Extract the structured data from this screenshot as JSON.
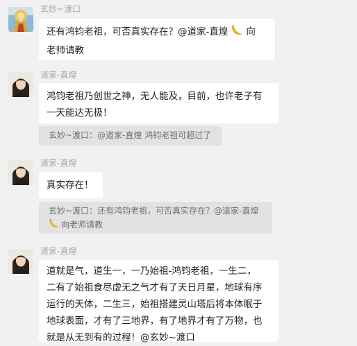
{
  "messages": [
    {
      "sender": "玄妙~渡口",
      "text_lines": [
        "还有鸿钧老祖，可否真实存在？@道家-直煌",
        "向",
        "老师请教"
      ],
      "emoji": "banana-emoji"
    },
    {
      "sender": "道家-直煌",
      "text_lines": [
        "鸿钧老祖乃创世之神，无人能及，目前，也许老子有",
        "一天能达无极！"
      ],
      "quote": "玄妙~渡口：@道家-直煌 鸿钧老祖可超过了"
    },
    {
      "sender": "道家-直煌",
      "text_lines": [
        "真实存在！"
      ],
      "quote_lines": [
        "玄妙~渡口：还有鸿钧老祖，可否真实存在？@道家-直煌",
        "向老师请教"
      ]
    },
    {
      "sender": "道家-直煌",
      "text_lines": [
        "道就是气，道生一，一乃始祖-鸿钧老祖，一生二，",
        "二有了始祖食尽虚无之气才有了天日月星，地球有序",
        "运行的天体，二生三，始祖搭建灵山塔后将本体眠于",
        "地球表面，才有了三地界，有了地界才有了万物，也",
        "就是从无到有的过程！@玄妙~渡口"
      ]
    }
  ],
  "colors": {
    "background": "#f1f1f1",
    "bubble": "#ffffff",
    "quote": "#e2e2e2",
    "sender_name": "#a7a7a7"
  }
}
